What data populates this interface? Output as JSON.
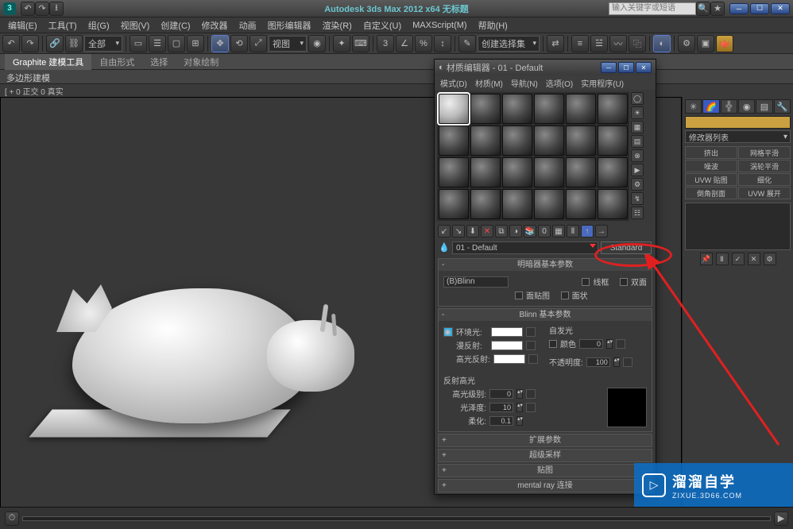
{
  "app": {
    "title": "Autodesk 3ds Max 2012 x64   无标题",
    "searchPlaceholder": "输入关键字或短语"
  },
  "menu": [
    "编辑(E)",
    "工具(T)",
    "组(G)",
    "视图(V)",
    "创建(C)",
    "修改器",
    "动画",
    "图形编辑器",
    "渲染(R)",
    "自定义(U)",
    "MAXScript(M)",
    "帮助(H)"
  ],
  "toolbar": {
    "selFilter": "全部",
    "viewType": "视图",
    "selSet": "创建选择集"
  },
  "ribbon": {
    "tabs": [
      "Graphite 建模工具",
      "自由形式",
      "选择",
      "对象绘制"
    ],
    "sub": "多边形建模"
  },
  "viewport": {
    "label": "[ + 0 正交 0 真实"
  },
  "matEditor": {
    "title": "材质编辑器 - 01 - Default",
    "menu": [
      "模式(D)",
      "材质(M)",
      "导航(N)",
      "选项(O)",
      "实用程序(U)"
    ],
    "matName": "01 - Default",
    "matType": "Standard",
    "rollouts": {
      "shader": {
        "title": "明暗器基本参数",
        "shading": "(B)Blinn",
        "wire": "线框",
        "twoSided": "双面",
        "faceMap": "面贴图",
        "faceted": "面状"
      },
      "blinn": {
        "title": "Blinn 基本参数",
        "ambient": "环境光:",
        "diffuse": "漫反射:",
        "specular": "高光反射:",
        "selfIllum": "自发光",
        "color": "颜色",
        "colorVal": "0",
        "opacity": "不透明度:",
        "opacityVal": "100",
        "specHighlights": "反射高光",
        "specLevel": "高光级别:",
        "specLevelVal": "0",
        "gloss": "光泽度:",
        "glossVal": "10",
        "soften": "柔化:",
        "softenVal": "0.1"
      },
      "ext": "扩展参数",
      "ss": "超级采样",
      "maps": "贴图",
      "mr": "mental ray 连接"
    }
  },
  "cmdPanel": {
    "modList": "修改器列表",
    "mods": [
      "挤出",
      "网格平滑",
      "噪波",
      "涡轮平滑",
      "UVW 贴图",
      "细化",
      "倒角剖面",
      "UVW 展开"
    ]
  },
  "watermark": {
    "brand": "溜溜自学",
    "url": "ZIXUE.3D66.COM"
  }
}
